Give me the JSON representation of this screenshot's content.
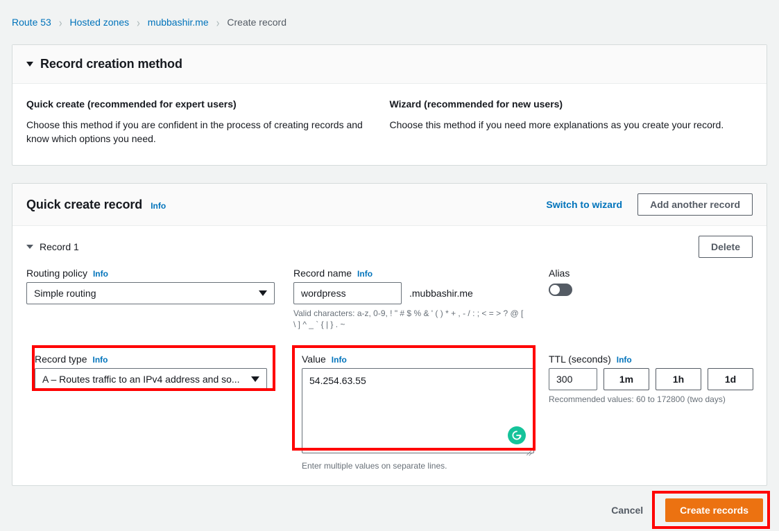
{
  "breadcrumb": {
    "items": [
      {
        "label": "Route 53",
        "type": "link"
      },
      {
        "label": "Hosted zones",
        "type": "link"
      },
      {
        "label": "mubbashir.me",
        "type": "link"
      },
      {
        "label": "Create record",
        "type": "current"
      }
    ],
    "separator": "›"
  },
  "method_panel": {
    "title": "Record creation method",
    "quick": {
      "heading": "Quick create (recommended for expert users)",
      "description": "Choose this method if you are confident in the process of creating records and know which options you need."
    },
    "wizard": {
      "heading": "Wizard (recommended for new users)",
      "description": "Choose this method if you need more explanations as you create your record."
    }
  },
  "quick_create": {
    "title": "Quick create record",
    "info_label": "Info",
    "switch_to_wizard": "Switch to wizard",
    "add_another_record": "Add another record",
    "record_heading": "Record 1",
    "delete_label": "Delete",
    "routing_policy": {
      "label": "Routing policy",
      "info_label": "Info",
      "value": "Simple routing"
    },
    "record_name": {
      "label": "Record name",
      "info_label": "Info",
      "value": "wordpress",
      "placeholder": "",
      "suffix": ".mubbashir.me",
      "help": "Valid characters: a-z, 0-9, ! \" # $ % & ' ( ) * + , - / : ; < = > ? @ [ \\ ] ^ _ ` { | } . ~"
    },
    "alias": {
      "label": "Alias",
      "enabled": false
    },
    "record_type": {
      "label": "Record type",
      "info_label": "Info",
      "value": "A – Routes traffic to an IPv4 address and so..."
    },
    "value_field": {
      "label": "Value",
      "info_label": "Info",
      "value": "54.254.63.55",
      "help": "Enter multiple values on separate lines."
    },
    "ttl": {
      "label": "TTL (seconds)",
      "info_label": "Info",
      "value": "300",
      "presets": [
        "1m",
        "1h",
        "1d"
      ],
      "help": "Recommended values: 60 to 172800 (two days)"
    }
  },
  "footer": {
    "cancel_label": "Cancel",
    "create_label": "Create records"
  },
  "colors": {
    "link": "#0073bb",
    "primary_button": "#ec7211",
    "annotation": "#ff0000",
    "page_background": "#f1f3f3",
    "grammarly_green": "#15c39a"
  }
}
